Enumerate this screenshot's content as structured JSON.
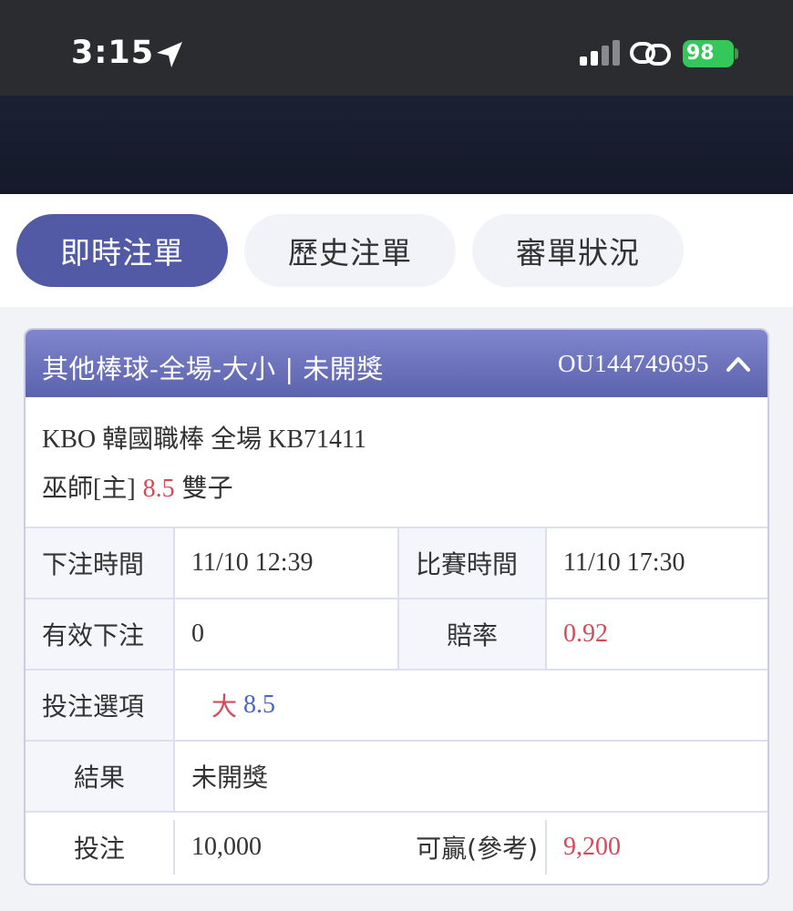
{
  "status_bar": {
    "time": "3:15",
    "battery": "98"
  },
  "tabs": [
    {
      "label": "即時注單",
      "active": true
    },
    {
      "label": "歷史注單",
      "active": false
    },
    {
      "label": "審單狀況",
      "active": false
    }
  ],
  "bet": {
    "title": "其他棒球-全場-大小 | 未開獎",
    "id": "OU144749695",
    "league_line": "KBO 韓國職棒 全場 KB71411",
    "pick_team": "巫師[主]",
    "pick_line": "8.5",
    "pick_opponent": "雙子",
    "details": {
      "bet_time_label": "下注時間",
      "bet_time_value": "11/10 12:39",
      "match_time_label": "比賽時間",
      "match_time_value": "11/10 17:30",
      "valid_bet_label": "有效下注",
      "valid_bet_value": "0",
      "odds_label": "賠率",
      "odds_value": "0.92",
      "option_label": "投注選項",
      "option_side": "大",
      "option_line": "8.5",
      "result_label": "結果",
      "result_value": "未開獎",
      "stake_label": "投注",
      "stake_value": "10,000",
      "win_label": "可贏(參考)",
      "win_value": "9,200"
    }
  },
  "colors": {
    "accent": "#525aa6",
    "header": "#6d74bd",
    "highlight_red": "#d24b5a",
    "highlight_blue": "#4c66c4"
  }
}
